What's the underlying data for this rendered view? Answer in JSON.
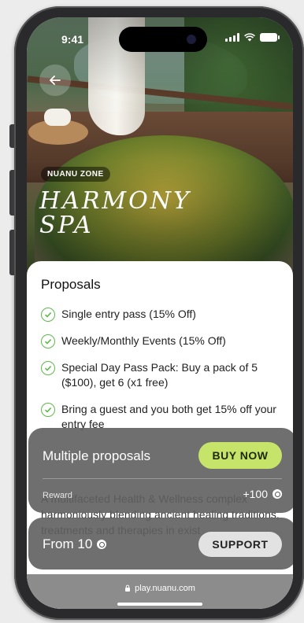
{
  "status_bar": {
    "time": "9:41"
  },
  "hero": {
    "zone_label": "NUANU ZONE",
    "title_line1": "HARMONY",
    "title_line2": "SPA"
  },
  "proposals": {
    "heading": "Proposals",
    "items": [
      "Single entry pass (15% Off)",
      "Weekly/Monthly Events (15% Off)",
      "Special Day Pass Pack: Buy a pack of 5 ($100), get 6 (x1 free)",
      "Bring a guest and you both get 15% off your entry fee"
    ],
    "description": "A multifaceted Health & Wellness complex harmoniously blending ancient healing traditions, treatments and therapies in exist"
  },
  "offer_card": {
    "label": "Multiple proposals",
    "buy_label": "BUY NOW",
    "reward_label": "Reward",
    "reward_value": "+100"
  },
  "price_card": {
    "from_label": "From 10",
    "support_label": "SUPPORT"
  },
  "browser": {
    "url": "play.nuanu.com"
  },
  "colors": {
    "accent": "#c6e46a",
    "check": "#5fb84a",
    "card_bg": "#5f5f5f"
  }
}
